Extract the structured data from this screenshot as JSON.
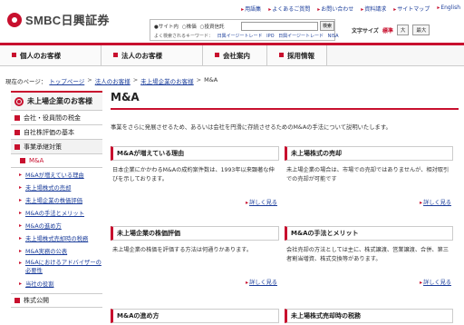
{
  "header": {
    "logo_text": "SMBC日興証券",
    "util_links": [
      "用語集",
      "よくあるご質問",
      "お問い合わせ",
      "資料請求",
      "サイトマップ",
      "English"
    ],
    "search": {
      "radios": [
        "サイト内",
        "株価",
        "投資信託"
      ],
      "selected_radio": "サイト内",
      "placeholder": "",
      "button_label": "検索",
      "keyword_label": "よく検索されるキーワード：",
      "keywords": [
        "日興イージートレード",
        "IPO",
        "日興イージートレード",
        "NISA"
      ]
    },
    "font_size": {
      "label": "文字サイズ",
      "options": [
        "標準",
        "大",
        "最大"
      ]
    }
  },
  "gnav": {
    "items": [
      "個人のお客様",
      "法人のお客様",
      "会社案内",
      "採用情報"
    ]
  },
  "breadcrumb": {
    "prefix": "現在のページ：",
    "items": [
      "トップページ",
      "法人のお客様",
      "未上場企業のお客様",
      "M&A"
    ]
  },
  "sidebar": {
    "title": "未上場企業のお客様",
    "sections": [
      "会社・役員間の税金",
      "自社株評価の基本",
      "事業承継対策"
    ],
    "current": "M&A",
    "links": [
      "M&Aが増えている理由",
      "未上場株式の売却",
      "未上場企業の株価評価",
      "M&Aの手法とメリット",
      "M&Aの進め方",
      "未上場株式売却時の税務",
      "M&A実務の公表",
      "M&Aにおけるアドバイザーの必要性",
      "当社の役割"
    ],
    "bottom_section": "株式公開"
  },
  "main": {
    "title": "M&A",
    "intro": "事業をさらに発展させるため、あるいは会社を円滑に存続させるためのM&Aの手法について説明いたします。",
    "more_label": "詳しく見る",
    "cards": [
      {
        "title": "M&Aが増えている理由",
        "body": "日本企業にかかわるM&Aの成約案件数は、1993年以来顕著な伸びを示しております。"
      },
      {
        "title": "未上場株式の売却",
        "body": "未上場企業の場合は、市場での売却ではありませんが、相対取引での売却が可能です"
      },
      {
        "title": "未上場企業の株価評価",
        "body": "未上場企業の株価を評価する方法は何通りかあります。"
      },
      {
        "title": "M&Aの手法とメリット",
        "body": "会社売却の方法としては主に、株式譲渡、営業譲渡、合併、第三者割当増資、株式交換等があります。"
      },
      {
        "title": "M&Aの進め方",
        "body": ""
      },
      {
        "title": "未上場株式売却時の税務",
        "body": ""
      }
    ]
  }
}
